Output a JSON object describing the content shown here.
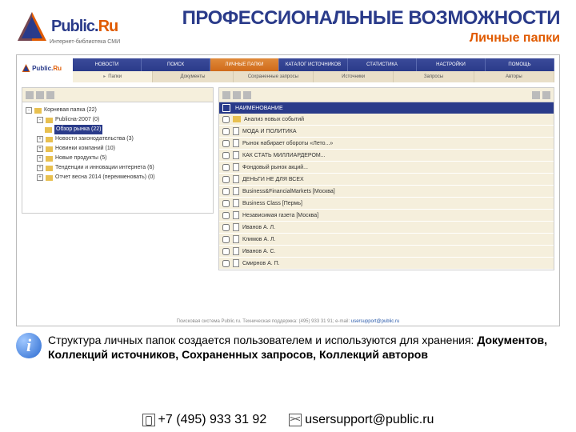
{
  "header": {
    "brand_main": "Public.",
    "brand_ru": "Ru",
    "brand_sub": "Интернет-библиотека СМИ",
    "title": "ПРОФЕССИОНАЛЬНЫЕ ВОЗМОЖНОСТИ",
    "subtitle": "Личные папки"
  },
  "app": {
    "nav": [
      "НОВОСТИ",
      "ПОИСК",
      "ЛИЧНЫЕ ПАПКИ",
      "КАТАЛОГ ИСТОЧНИКОВ",
      "СТАТИСТИКА",
      "НАСТРОЙКИ",
      "ПОМОЩЬ"
    ],
    "nav_active_index": 2,
    "subnav_arrow": "▸",
    "subnav": [
      "Папки",
      "Документы",
      "Сохраненные запросы",
      "Источники",
      "Запросы",
      "Авторы"
    ],
    "tree": [
      {
        "level": 0,
        "exp": "-",
        "label": "Корневая папка (22)",
        "active": false
      },
      {
        "level": 1,
        "exp": "-",
        "label": "Publicна-2007 (0)",
        "active": false
      },
      {
        "level": 2,
        "exp": "",
        "label": "Обзор рынка (22)",
        "active": true
      },
      {
        "level": 1,
        "exp": "+",
        "label": "Новости законодательства (3)",
        "active": false
      },
      {
        "level": 1,
        "exp": "+",
        "label": "Новинки компаний (10)",
        "active": false
      },
      {
        "level": 1,
        "exp": "+",
        "label": "Новые продукты (5)",
        "active": false
      },
      {
        "level": 1,
        "exp": "+",
        "label": "Тенденции и инновации интернета (6)",
        "active": false
      },
      {
        "level": 1,
        "exp": "+",
        "label": "Отчет весна 2014 (переименовать) (0)",
        "active": false
      }
    ],
    "table_header": "НАИМЕНОВАНИЕ",
    "rows": [
      {
        "type": "folder",
        "label": "Анализ новых событий"
      },
      {
        "type": "doc",
        "label": "МОДА И ПОЛИТИКА"
      },
      {
        "type": "doc",
        "label": "Рынок набирает обороты «Лето...»"
      },
      {
        "type": "doc",
        "label": "КАК СТАТЬ МИЛЛИАРДЕРОМ..."
      },
      {
        "type": "doc",
        "label": "Фондовый рынок акций..."
      },
      {
        "type": "doc",
        "label": "ДЕНЬГИ НЕ ДЛЯ ВСЕХ"
      },
      {
        "type": "doc",
        "label": "Business&FinancialMarkets [Москва]"
      },
      {
        "type": "doc",
        "label": "Business Class [Пермь]"
      },
      {
        "type": "doc",
        "label": "Независимая газета [Москва]"
      },
      {
        "type": "doc",
        "label": "Иванов А. Л."
      },
      {
        "type": "doc",
        "label": "Климов А. Л."
      },
      {
        "type": "doc",
        "label": "Иванов А. С."
      },
      {
        "type": "doc",
        "label": "Смирнов А. П."
      }
    ],
    "footer_text": "Поисковая система Public.ru. Техническая поддержка: (495) 933 31 91; e-mail: ",
    "footer_email": "usersupport@public.ru"
  },
  "info": {
    "text_pre": "Структура личных папок создается пользователем и используются для хранения:   ",
    "b1": "Документов,",
    "gap1": "   ",
    "b2": "Коллекций источников, Сохраненных запросов,",
    "gap2": "   ",
    "b3": "Коллекций авторов"
  },
  "footer": {
    "phone": "+7 (495) 933 31 92",
    "email": "usersupport@public.ru"
  }
}
